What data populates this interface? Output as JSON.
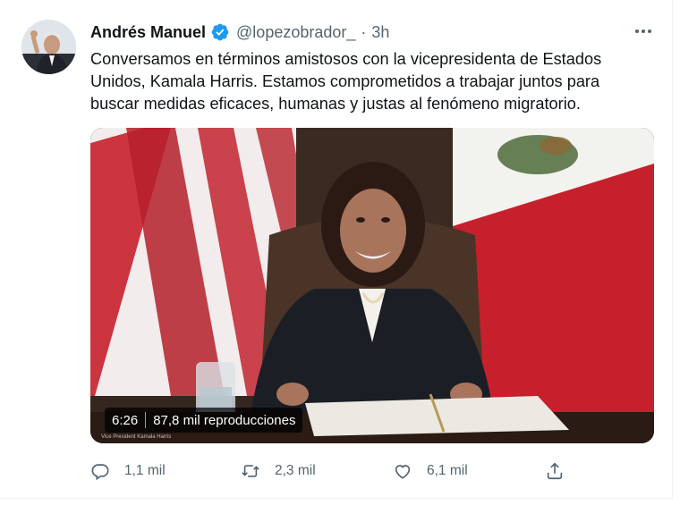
{
  "tweet": {
    "author_name": "Andrés Manuel",
    "handle": "@lopezobrador_",
    "separator": "·",
    "time": "3h",
    "text_lines": [
      "Conversamos en términos amistosos con la vicepresidenta de Estados",
      "Unidos, Kamala Harris. Estamos comprometidos a trabajar juntos para",
      "buscar medidas eficaces, humanas y justas al fenómeno migratorio."
    ],
    "media": {
      "duration": "6:26",
      "views": "87,8 mil reproducciones",
      "caption": "Vice President Kamala Harris"
    },
    "actions": {
      "replies": "1,1 mil",
      "retweets": "2,3 mil",
      "likes": "6,1 mil"
    }
  },
  "colors": {
    "text": "#0f1419",
    "secondary": "#536471",
    "verified": "#1d9bf0"
  },
  "icons": [
    "verified-badge-icon",
    "more-icon",
    "reply-icon",
    "retweet-icon",
    "like-icon",
    "share-icon"
  ]
}
